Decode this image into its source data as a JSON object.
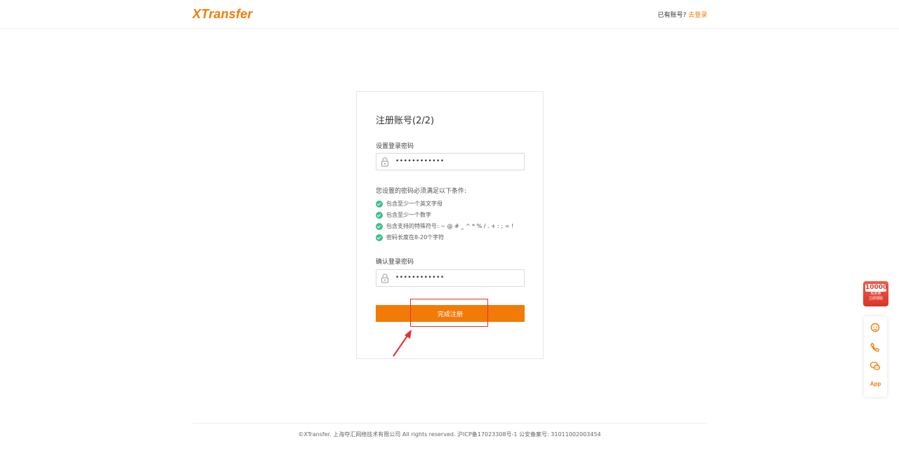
{
  "header": {
    "logo_text": "XTransfer",
    "login_prompt": "已有账号?",
    "login_link": "去登录"
  },
  "form": {
    "title": "注册账号(2/2)",
    "password_label": "设置登录密码",
    "password_value": "••••••••••••",
    "rules_title": "您设置的密码必须满足以下条件:",
    "rules": [
      "包含至少一个英文字母",
      "包含至少一个数字",
      "包含支持的特殊符号: ~ @ # _ ^ * % / . + : ; = !",
      "密码长度在8-20个字符"
    ],
    "confirm_label": "确认登录密码",
    "confirm_value": "••••••••••••",
    "submit_label": "完成注册"
  },
  "footer": {
    "copyright": "©XTransfer. 上海夺汇网络技术有限公司 All rights reserved. 沪ICP备17023308号-1 公安备案号: 31011002003454"
  },
  "float": {
    "badge_number": "10000",
    "badge_line1": "现奖券",
    "badge_line2": "立即领取",
    "icons": [
      "support-agent-icon",
      "phone-icon",
      "wechat-icon"
    ],
    "app_label": "App"
  },
  "colors": {
    "brand": "#f27b07",
    "success": "#3fbf8a",
    "annotation": "#e62e2e"
  }
}
